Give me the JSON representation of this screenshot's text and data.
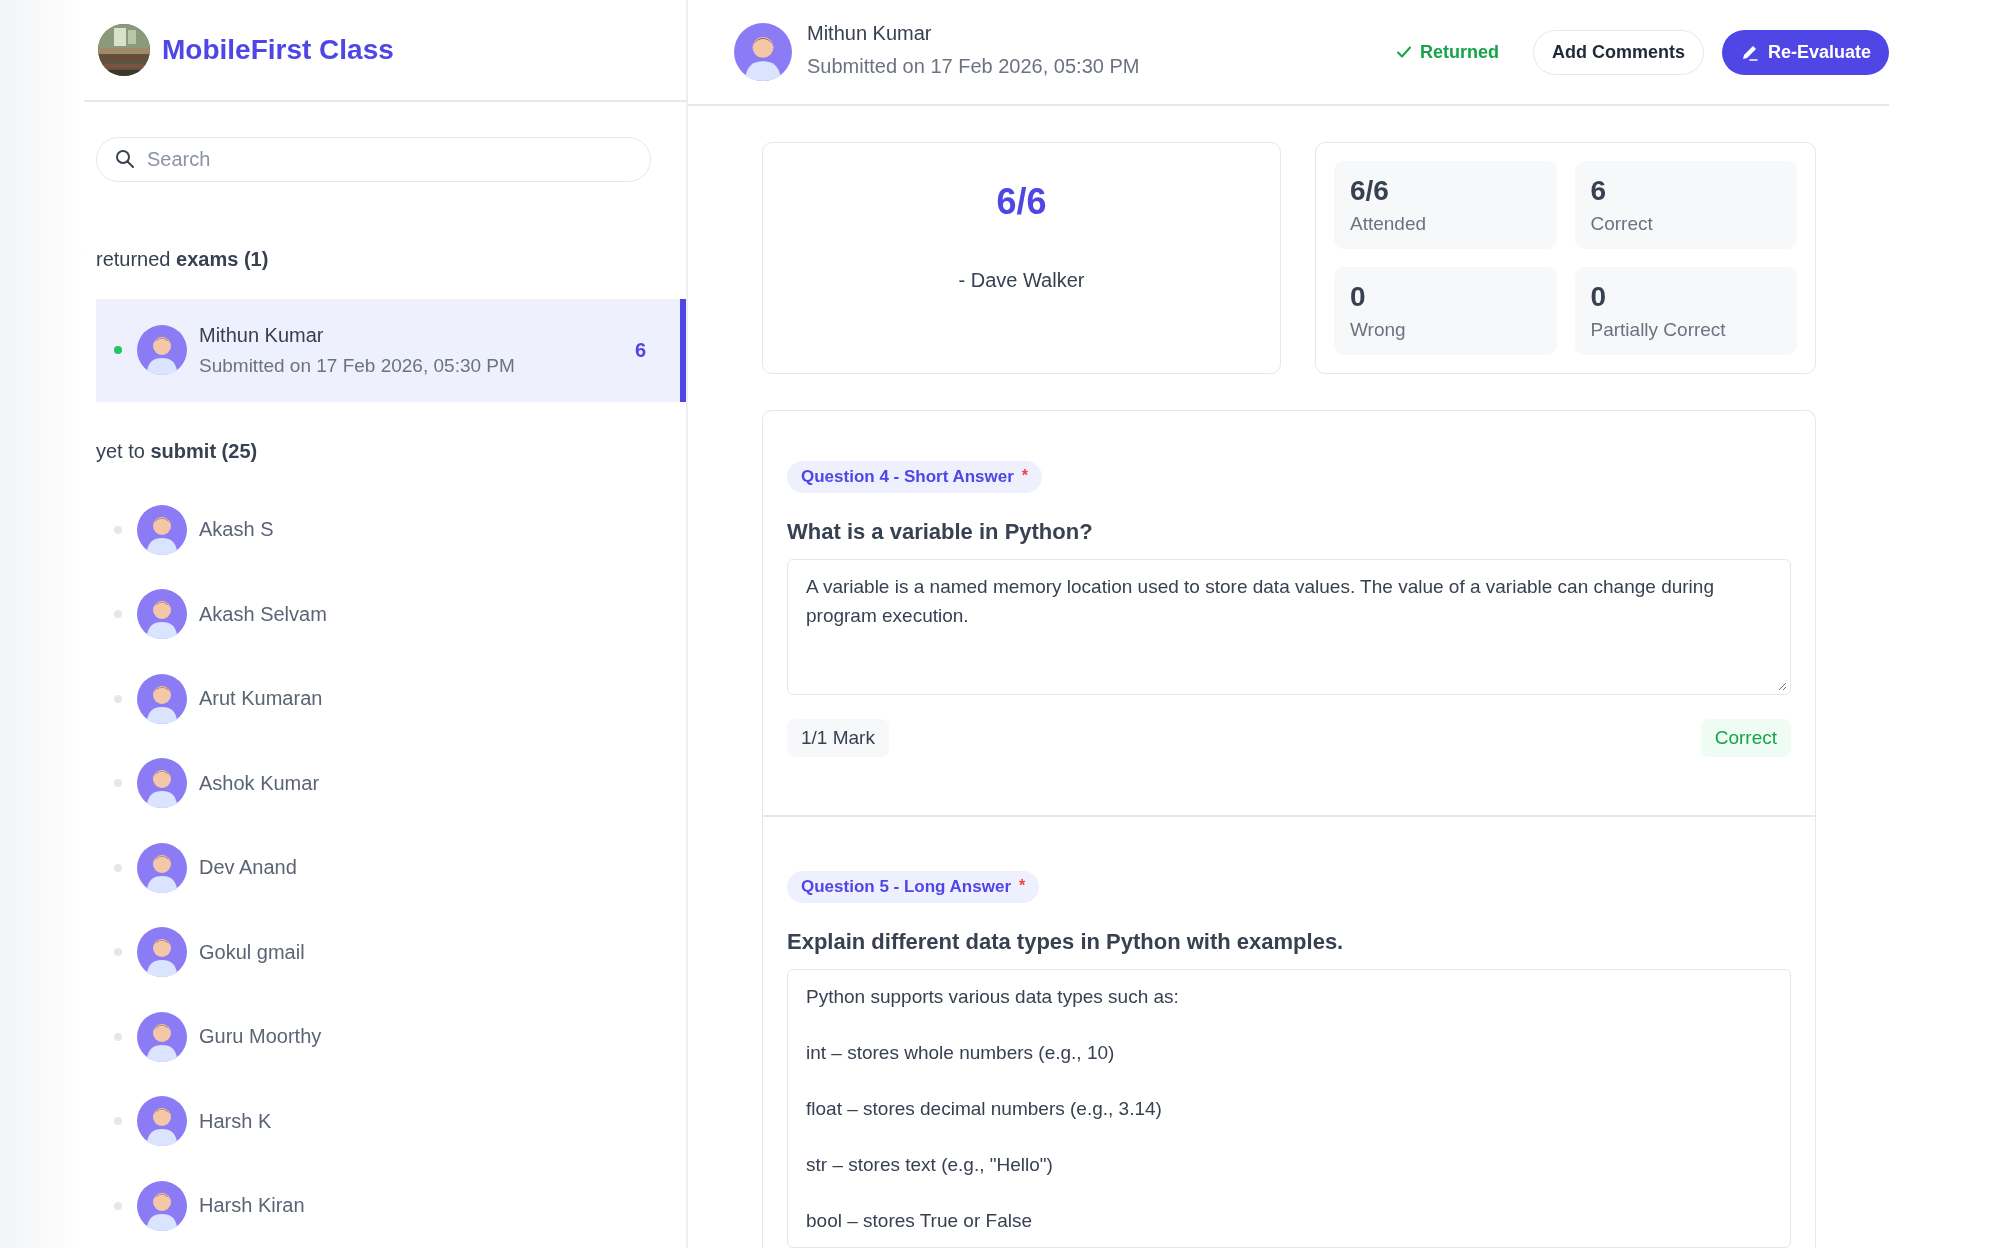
{
  "app": {
    "title": "MobileFirst Class"
  },
  "search": {
    "placeholder": "Search"
  },
  "returned_heading": "returned **exams (1)**",
  "returned": [
    {
      "name": "Mithun Kumar",
      "subtitle": "Submitted on 17 Feb 2026, 05:30 PM",
      "score": "6",
      "selected": true,
      "color": "#22c55e"
    }
  ],
  "pending_heading": "yet to **submit (25)**",
  "pending": [
    {
      "name": "Akash S",
      "selected": false,
      "color": "#e5e7eb"
    },
    {
      "name": "Akash Selvam",
      "selected": false,
      "color": "#e5e7eb"
    },
    {
      "name": "Arut Kumaran",
      "selected": false,
      "color": "#e5e7eb"
    },
    {
      "name": "Ashok Kumar",
      "selected": false,
      "color": "#e5e7eb"
    },
    {
      "name": "Dev Anand",
      "selected": false,
      "color": "#e5e7eb"
    },
    {
      "name": "Gokul gmail",
      "selected": false,
      "color": "#e5e7eb"
    },
    {
      "name": "Guru Moorthy",
      "selected": false,
      "color": "#e5e7eb"
    },
    {
      "name": "Harsh K",
      "selected": false,
      "color": "#e5e7eb"
    },
    {
      "name": "Harsh Kiran",
      "selected": false,
      "color": "#e5e7eb"
    }
  ],
  "header": {
    "name": "Mithun Kumar",
    "subtitle": "Submitted on 17 Feb 2026, 05:30 PM",
    "status": "Returned",
    "buttons": [
      {
        "label": "Add Comments",
        "kind": "outline"
      },
      {
        "label": "Re-Evaluate",
        "kind": "primary"
      }
    ]
  },
  "score": {
    "value": "6/6",
    "evaluator": "- Dave Walker"
  },
  "stats": [
    {
      "value": "6/6",
      "label": "Attended"
    },
    {
      "value": "6",
      "label": "Correct"
    },
    {
      "value": "0",
      "label": "Wrong"
    },
    {
      "value": "0",
      "label": "Partially Correct"
    }
  ],
  "questions": [
    {
      "tag": "Question 4 - Short Answer",
      "marker": "*",
      "title": "What is a variable in Python?",
      "answer": [
        "A variable is a named memory location used to store data values. The value of a variable can change during program execution."
      ],
      "mark": "1/1 Mark",
      "result": "Correct"
    },
    {
      "tag": "Question 5 - Long Answer",
      "marker": "*",
      "title": "Explain different data types in Python with examples.",
      "answer": [
        "Python supports various data types such as:",
        "int – stores whole numbers (e.g., 10)",
        "float – stores decimal numbers (e.g., 3.14)",
        "str – stores text (e.g., \"Hello\")",
        "bool – stores True or False"
      ]
    }
  ]
}
